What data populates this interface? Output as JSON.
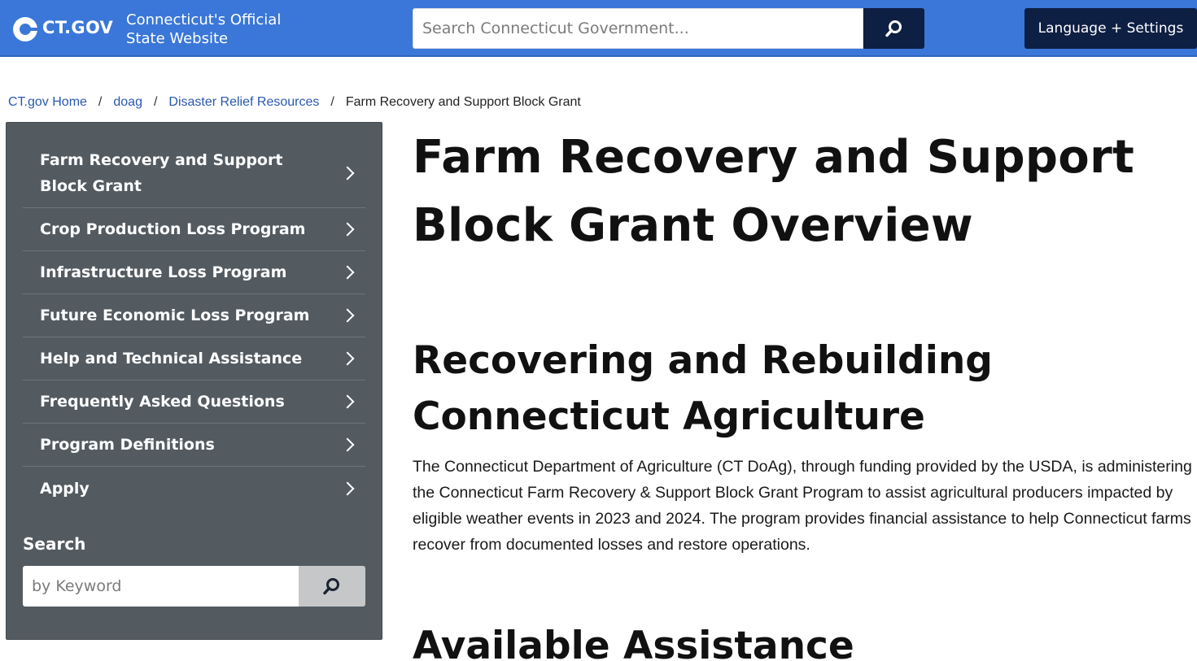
{
  "header": {
    "brand": "CT.GOV",
    "tagline": "Connecticut's Official State Website",
    "search_placeholder": "Search Connecticut Government...",
    "language_button": "Language + Settings"
  },
  "breadcrumb": {
    "items": [
      "CT.gov Home",
      "doag",
      "Disaster Relief Resources"
    ],
    "current": "Farm Recovery and Support Block Grant",
    "separator": "/"
  },
  "sidebar": {
    "items": [
      {
        "label": "Farm Recovery and Support Block Grant"
      },
      {
        "label": "Crop Production Loss Program"
      },
      {
        "label": "Infrastructure Loss Program"
      },
      {
        "label": "Future Economic Loss Program"
      },
      {
        "label": "Help and Technical Assistance"
      },
      {
        "label": "Frequently Asked Questions"
      },
      {
        "label": "Program Definitions"
      },
      {
        "label": "Apply"
      }
    ],
    "search_label": "Search",
    "search_placeholder": "by Keyword"
  },
  "main": {
    "title": "Farm Recovery and Support Block Grant Overview",
    "section_title": "Recovering and Rebuilding Connecticut Agriculture",
    "paragraph": "The Connecticut Department of Agriculture (CT DoAg), through funding provided by the USDA, is administering the Connecticut Farm Recovery & Support Block Grant Program to assist agricultural producers impacted by eligible weather events in 2023 and 2024. The program provides financial assistance to help Connecticut farms recover from documented losses and restore operations.",
    "next_section_title": "Available Assistance"
  },
  "colors": {
    "header_blue": "#3a77d8",
    "navy": "#0e1f44",
    "sidebar_gray": "#535b61",
    "link_blue": "#2a58b0"
  }
}
